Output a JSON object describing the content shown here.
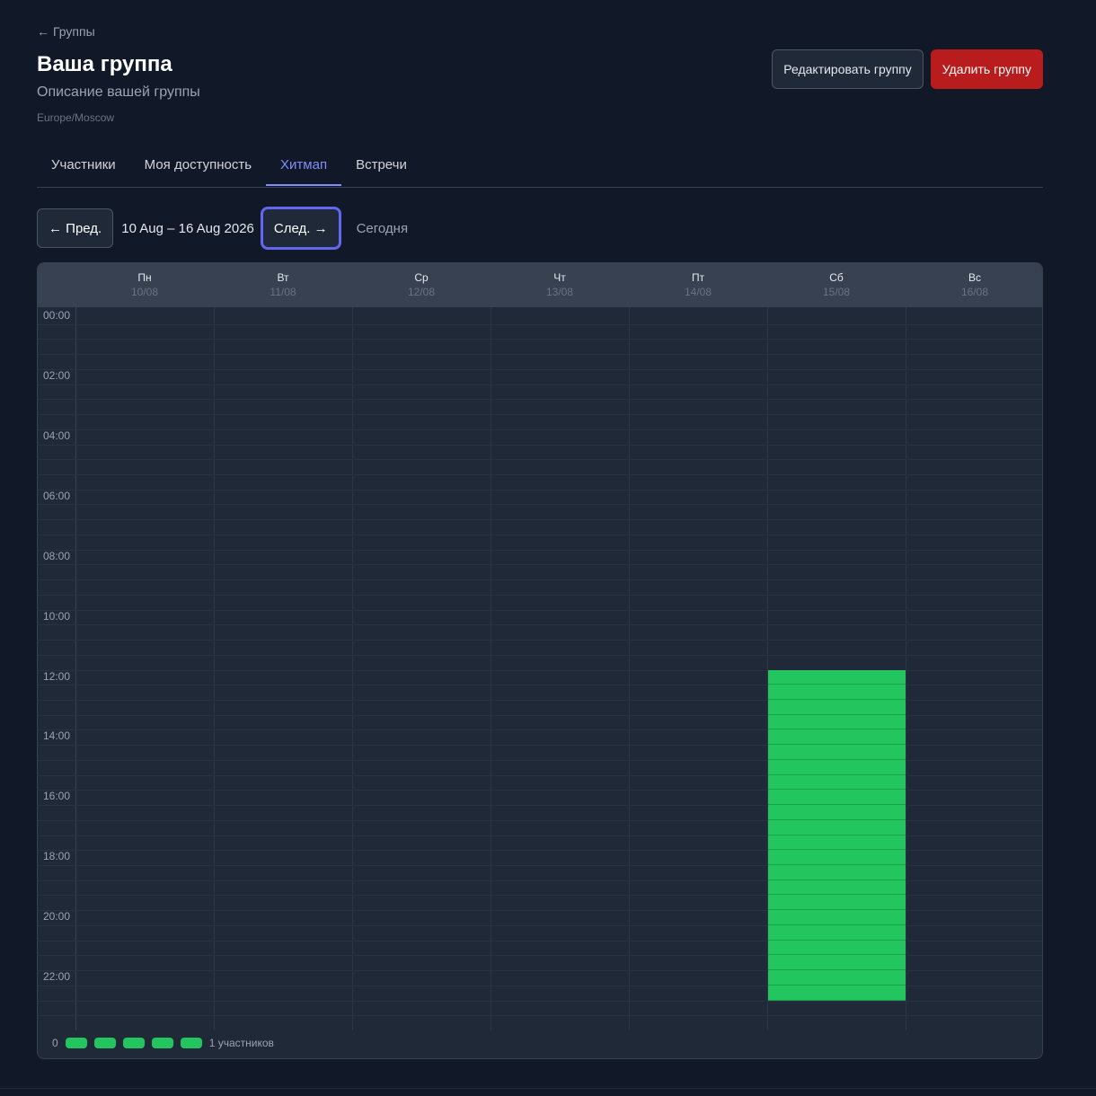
{
  "back": {
    "arrow": "←",
    "label": "Группы"
  },
  "group": {
    "title": "Ваша группа",
    "description": "Описание вашей группы",
    "timezone": "Europe/Moscow"
  },
  "actions": {
    "edit_label": "Редактировать группу",
    "delete_label": "Удалить группу"
  },
  "tabs": [
    {
      "label": "Участники",
      "active": false
    },
    {
      "label": "Моя доступность",
      "active": false
    },
    {
      "label": "Хитмап",
      "active": true
    },
    {
      "label": "Встречи",
      "active": false
    }
  ],
  "toolbar": {
    "prev_label": "← Пред.",
    "range": "10 Aug – 16 Aug 2026",
    "next_label": "След. →",
    "today_label": "Сегодня"
  },
  "heatmap": {
    "days": [
      {
        "name": "Пн",
        "date": "10/08"
      },
      {
        "name": "Вт",
        "date": "11/08"
      },
      {
        "name": "Ср",
        "date": "12/08"
      },
      {
        "name": "Чт",
        "date": "13/08"
      },
      {
        "name": "Пт",
        "date": "14/08"
      },
      {
        "name": "Сб",
        "date": "15/08"
      },
      {
        "name": "Вс",
        "date": "16/08"
      }
    ],
    "time_labels": [
      "00:00",
      "02:00",
      "04:00",
      "06:00",
      "08:00",
      "10:00",
      "12:00",
      "14:00",
      "16:00",
      "18:00",
      "20:00",
      "22:00"
    ],
    "slots_per_hour": 2,
    "max_participants": 1,
    "available": [
      {
        "day": 5,
        "from": "12:00",
        "to": "23:00",
        "count": 1
      }
    ],
    "colors": {
      "available": "#22c55e",
      "accent": "#818cf8",
      "danger": "#b91c1c"
    }
  },
  "legend": {
    "min_label": "0",
    "max_label": "1 участников",
    "swatch_count": 5
  }
}
